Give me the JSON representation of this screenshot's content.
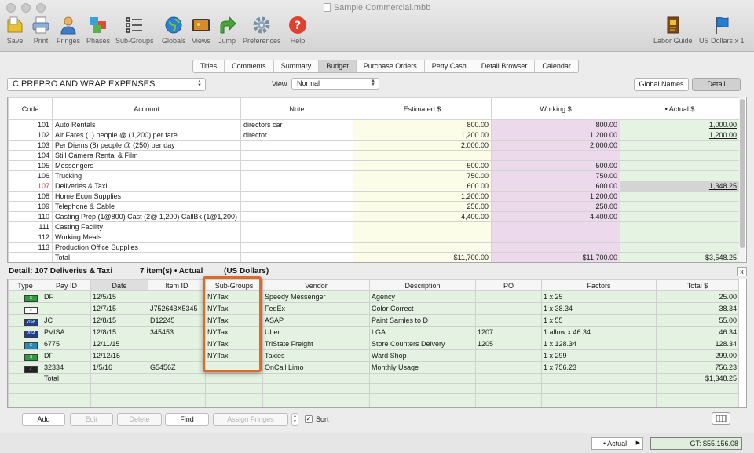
{
  "window": {
    "title": "Sample Commercial.mbb"
  },
  "toolbar": {
    "left": [
      {
        "label": "Save",
        "icon": "save-icon"
      },
      {
        "label": "Print",
        "icon": "print-icon"
      },
      {
        "label": "Fringes",
        "icon": "fringes-icon"
      },
      {
        "label": "Phases",
        "icon": "phases-icon"
      },
      {
        "label": "Sub-Groups",
        "icon": "subgroups-icon"
      },
      {
        "label": "Globals",
        "icon": "globe-icon"
      },
      {
        "label": "Views",
        "icon": "views-icon"
      },
      {
        "label": "Jump",
        "icon": "jump-arrow-icon"
      },
      {
        "label": "Preferences",
        "icon": "gear-icon"
      },
      {
        "label": "Help",
        "icon": "help-icon"
      }
    ],
    "right": [
      {
        "label": "Labor Guide",
        "icon": "labor-guide-icon"
      },
      {
        "label": "US Dollars x 1",
        "icon": "flag-icon"
      }
    ]
  },
  "tabs": [
    "Titles",
    "Comments",
    "Summary",
    "Budget",
    "Purchase Orders",
    "Petty Cash",
    "Detail Browser",
    "Calendar"
  ],
  "active_tab": "Budget",
  "account_selector": "C  PREPRO AND WRAP EXPENSES",
  "view": {
    "label": "View",
    "value": "Normal"
  },
  "buttons": {
    "global_names": "Global Names",
    "detail": "Detail"
  },
  "budget_table": {
    "headers": [
      "Code",
      "Account",
      "Note",
      "Estimated $",
      "Working $",
      "• Actual $"
    ],
    "rows": [
      {
        "code": "101",
        "account": "Auto Rentals",
        "note": "directors car",
        "estimated": "800.00",
        "working": "800.00",
        "actual": "1,000.00"
      },
      {
        "code": "102",
        "account": "Air Fares  (1) people @ (1,200) per fare",
        "note": "director",
        "estimated": "1,200.00",
        "working": "1,200.00",
        "actual": "1,200.00"
      },
      {
        "code": "103",
        "account": "Per Diems  (8) people @ (250) per day",
        "note": "",
        "estimated": "2,000.00",
        "working": "2,000.00",
        "actual": ""
      },
      {
        "code": "104",
        "account": "Still Camera Rental & Film",
        "note": "",
        "estimated": "",
        "working": "",
        "actual": ""
      },
      {
        "code": "105",
        "account": "Messengers",
        "note": "",
        "estimated": "500.00",
        "working": "500.00",
        "actual": ""
      },
      {
        "code": "106",
        "account": "Trucking",
        "note": "",
        "estimated": "750.00",
        "working": "750.00",
        "actual": ""
      },
      {
        "code": "107",
        "account": "Deliveries & Taxi",
        "note": "",
        "estimated": "600.00",
        "working": "600.00",
        "actual": "1,348.25"
      },
      {
        "code": "108",
        "account": "Home Econ Supplies",
        "note": "",
        "estimated": "1,200.00",
        "working": "1,200.00",
        "actual": ""
      },
      {
        "code": "109",
        "account": "Telephone & Cable",
        "note": "",
        "estimated": "250.00",
        "working": "250.00",
        "actual": ""
      },
      {
        "code": "110",
        "account": "Casting  Prep (1@800)  Cast (2@ 1,200)  CallBk (1@1,200)",
        "note": "",
        "estimated": "4,400.00",
        "working": "4,400.00",
        "actual": ""
      },
      {
        "code": "111",
        "account": "Casting Facility",
        "note": "",
        "estimated": "",
        "working": "",
        "actual": ""
      },
      {
        "code": "112",
        "account": "Working Meals",
        "note": "",
        "estimated": "",
        "working": "",
        "actual": ""
      },
      {
        "code": "113",
        "account": "Production Office Supplies",
        "note": "",
        "estimated": "",
        "working": "",
        "actual": ""
      }
    ],
    "total": {
      "label": "Total",
      "estimated": "$11,700.00",
      "working": "$11,700.00",
      "actual": "$3,548.25"
    }
  },
  "detail_header": {
    "title": "Detail:  107 Deliveries & Taxi",
    "items": "7 item(s)  • Actual",
    "currency": "(US Dollars)"
  },
  "detail_table": {
    "headers": [
      "Type",
      "Pay ID",
      "Date",
      "Item ID",
      "Sub-Groups",
      "Vendor",
      "Description",
      "PO",
      "Factors",
      "Total $"
    ],
    "rows": [
      {
        "type": "cash",
        "pay_id": "DF",
        "date": "12/5/15",
        "item_id": "",
        "subgroup": "NYTax",
        "vendor": "Speedy Messenger",
        "description": "Agency",
        "po": "",
        "factors": "1  x 25",
        "total": "25.00"
      },
      {
        "type": "check",
        "pay_id": "",
        "date": "12/7/15",
        "item_id": "J752643X5345",
        "subgroup": "NYTax",
        "vendor": "FedEx",
        "description": "Color Correct",
        "po": "",
        "factors": "1  x 38.34",
        "total": "38.34"
      },
      {
        "type": "card",
        "pay_id": "JC",
        "date": "12/8/15",
        "item_id": "D12245",
        "subgroup": "NYTax",
        "vendor": "ASAP",
        "description": "Paint Samles to D",
        "po": "",
        "factors": "1  x 55",
        "total": "55.00"
      },
      {
        "type": "card",
        "pay_id": "PVISA",
        "date": "12/8/15",
        "item_id": "345453",
        "subgroup": "NYTax",
        "vendor": "Uber",
        "description": "LGA",
        "po": "1207",
        "factors": "1  allow x 46.34",
        "total": "46.34"
      },
      {
        "type": "petty",
        "pay_id": "6775",
        "date": "12/11/15",
        "item_id": "",
        "subgroup": "NYTax",
        "vendor": "TriState Freight",
        "description": "Store Counters Deivery",
        "po": "1205",
        "factors": "1  x 128.34",
        "total": "128.34"
      },
      {
        "type": "cash",
        "pay_id": "DF",
        "date": "12/12/15",
        "item_id": "",
        "subgroup": "NYTax",
        "vendor": "Taxies",
        "description": "Ward Shop",
        "po": "",
        "factors": "1  x 299",
        "total": "299.00"
      },
      {
        "type": "wire",
        "pay_id": "32334",
        "date": "1/5/16",
        "item_id": "G5456Z",
        "subgroup": "",
        "vendor": "OnCall Limo",
        "description": "Monthly Usage",
        "po": "",
        "factors": "1  x 756.23",
        "total": "756.23"
      }
    ],
    "total": {
      "label": "Total",
      "value": "$1,348.25"
    }
  },
  "bottom_buttons": {
    "add": "Add",
    "edit": "Edit",
    "delete": "Delete",
    "find": "Find",
    "assign_fringes": "Assign Fringes",
    "sort": "Sort"
  },
  "status": {
    "actual": "• Actual",
    "gt": "GT: $55,156.08"
  },
  "colors": {
    "estimated": "#fbfde8",
    "working": "#ecd9ec",
    "actual": "#e5f3e3",
    "highlight": "#e06a2a"
  }
}
